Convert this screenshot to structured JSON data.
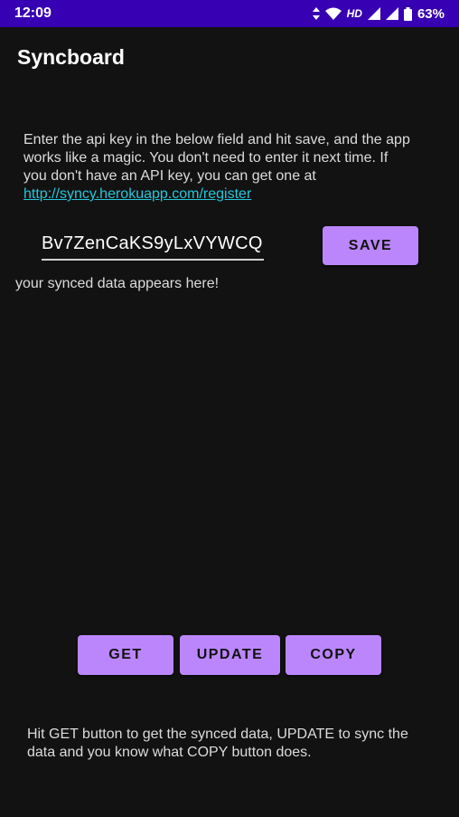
{
  "status_bar": {
    "time": "12:09",
    "network_label": "HD",
    "battery_percent": "63%",
    "icons": [
      "data-arrows-icon",
      "wifi-icon",
      "signal-icon",
      "signal-icon",
      "battery-icon"
    ]
  },
  "app_bar": {
    "title": "Syncboard"
  },
  "intro": {
    "text": "Enter the api key in the below field and hit save, and the app works like a magic. You don't need to enter it next time. If you don't have an API key, you can get one at",
    "link": "http://syncy.herokuapp.com/register"
  },
  "api_key": {
    "value": "Bv7ZenCaKS9yLxVYWCQ"
  },
  "save_button": {
    "label": "SAVE"
  },
  "synced_data": {
    "text": "your synced data appears here!"
  },
  "actions": {
    "get_label": "GET",
    "update_label": "UPDATE",
    "copy_label": "COPY"
  },
  "footer": {
    "text": "Hit GET button to get the synced data, UPDATE to sync the data and you know what COPY button does."
  },
  "colors": {
    "status_bar": "#3700b3",
    "background": "#121212",
    "accent": "#bb86fc",
    "link": "#26c6da"
  }
}
